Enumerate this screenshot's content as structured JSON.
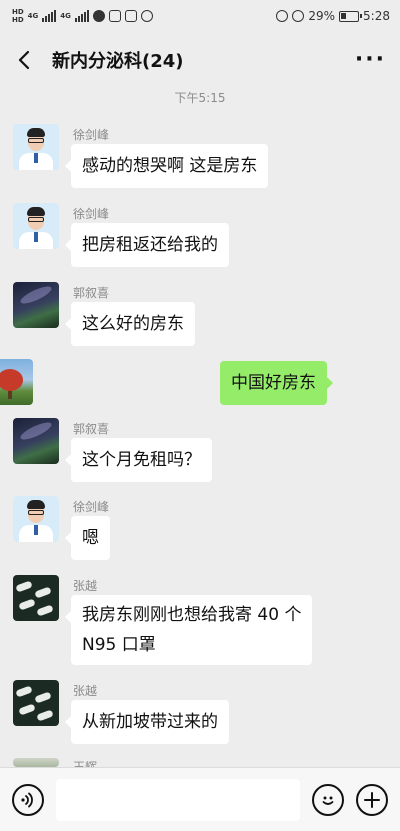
{
  "status": {
    "hd1": "HD",
    "hd2": "HD",
    "net1": "4G",
    "net2": "4G",
    "battery": "29%",
    "clock": "5:28"
  },
  "header": {
    "title": "新内分泌科(24)"
  },
  "timestamp": "下午5:15",
  "messages": [
    {
      "sender": "徐剑峰",
      "text": "感动的想哭啊  这是房东",
      "avatar": "man-glasses-avatar"
    },
    {
      "sender": "徐剑峰",
      "text": "把房租返还给我的",
      "avatar": "man-glasses-avatar"
    },
    {
      "sender": "郭叙喜",
      "text": "这么好的房东",
      "avatar": "night-sky-avatar"
    },
    {
      "sender": "",
      "text": "中国好房东",
      "avatar": "red-tree-avatar",
      "self": true
    },
    {
      "sender": "郭叙喜",
      "text": "这个月免租吗？",
      "avatar": "night-sky-avatar"
    },
    {
      "sender": "徐剑峰",
      "text": "嗯",
      "avatar": "man-glasses-avatar"
    },
    {
      "sender": "张越",
      "text_line1": "我房东刚刚也想给我寄 40 个",
      "text_line2": "N95 口罩",
      "avatar": "pills-avatar"
    },
    {
      "sender": "张越",
      "text": "从新加坡带过来的",
      "avatar": "pills-avatar"
    },
    {
      "sender": "王辉",
      "avatar": "partial-avatar"
    }
  ],
  "input": {
    "placeholder": "",
    "value": ""
  },
  "colors": {
    "background": "#ededed",
    "self_bubble": "#95ec69",
    "other_bubble": "#ffffff"
  }
}
